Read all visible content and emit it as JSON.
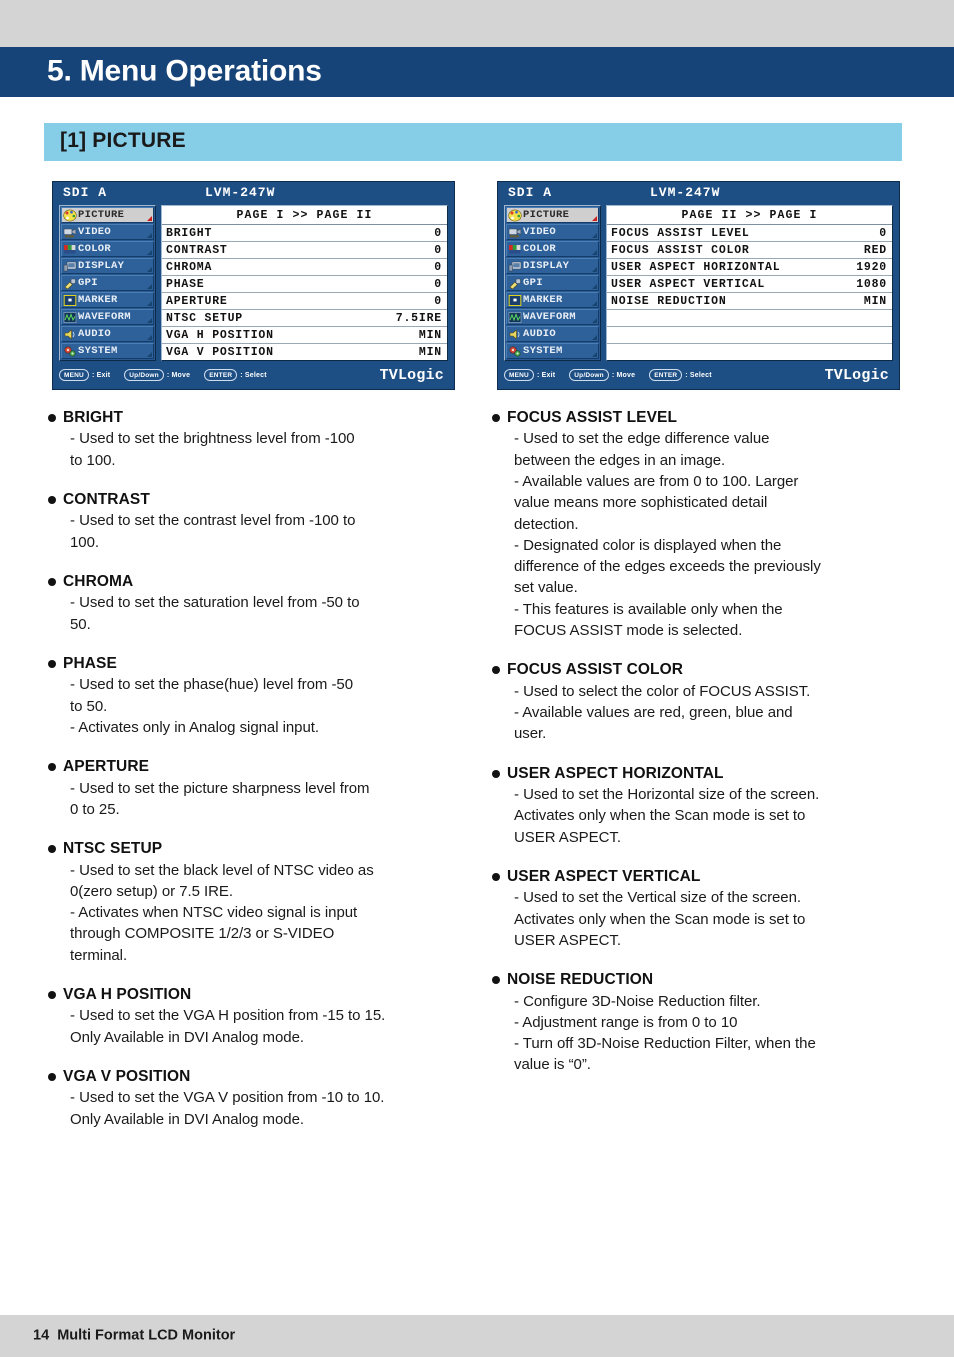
{
  "chapter": {
    "title": "5. Menu Operations"
  },
  "section": {
    "title": "[1] PICTURE"
  },
  "osd_panels": [
    {
      "source": "SDI A",
      "model": "LVM-247W",
      "page_label": "PAGE I >> PAGE II",
      "menu_items": [
        {
          "label": "PICTURE",
          "icon": "palette-icon",
          "active": true
        },
        {
          "label": "VIDEO",
          "icon": "camcorder-icon",
          "active": false
        },
        {
          "label": "COLOR",
          "icon": "color-bars-icon",
          "active": false
        },
        {
          "label": "DISPLAY",
          "icon": "monitor-icon",
          "active": false
        },
        {
          "label": "GPI",
          "icon": "plug-icon",
          "active": false
        },
        {
          "label": "MARKER",
          "icon": "frame-icon",
          "active": false
        },
        {
          "label": "WAVEFORM",
          "icon": "waveform-icon",
          "active": false
        },
        {
          "label": "AUDIO",
          "icon": "speaker-icon",
          "active": false
        },
        {
          "label": "SYSTEM",
          "icon": "gears-icon",
          "active": false
        }
      ],
      "rows": [
        {
          "label": "BRIGHT",
          "value": "0"
        },
        {
          "label": "CONTRAST",
          "value": "0"
        },
        {
          "label": "CHROMA",
          "value": "0"
        },
        {
          "label": "PHASE",
          "value": "0"
        },
        {
          "label": "APERTURE",
          "value": "0"
        },
        {
          "label": "NTSC SETUP",
          "value": "7.5IRE"
        },
        {
          "label": "VGA H POSITION",
          "value": "MIN"
        },
        {
          "label": "VGA V POSITION",
          "value": "MIN"
        }
      ],
      "footer": {
        "keys": [
          {
            "cap": "MENU",
            "text": ": Exit"
          },
          {
            "cap": "Up/Down",
            "text": ": Move"
          },
          {
            "cap": "ENTER",
            "text": ": Select"
          }
        ],
        "brand": "TVLogic"
      }
    },
    {
      "source": "SDI A",
      "model": "LVM-247W",
      "page_label": "PAGE II >> PAGE I",
      "menu_items": [
        {
          "label": "PICTURE",
          "icon": "palette-icon",
          "active": true
        },
        {
          "label": "VIDEO",
          "icon": "camcorder-icon",
          "active": false
        },
        {
          "label": "COLOR",
          "icon": "color-bars-icon",
          "active": false
        },
        {
          "label": "DISPLAY",
          "icon": "monitor-icon",
          "active": false
        },
        {
          "label": "GPI",
          "icon": "plug-icon",
          "active": false
        },
        {
          "label": "MARKER",
          "icon": "frame-icon",
          "active": false
        },
        {
          "label": "WAVEFORM",
          "icon": "waveform-icon",
          "active": false
        },
        {
          "label": "AUDIO",
          "icon": "speaker-icon",
          "active": false
        },
        {
          "label": "SYSTEM",
          "icon": "gears-icon",
          "active": false
        }
      ],
      "rows": [
        {
          "label": "FOCUS ASSIST LEVEL",
          "value": "0"
        },
        {
          "label": "FOCUS ASSIST COLOR",
          "value": "RED"
        },
        {
          "label": "USER ASPECT HORIZONTAL",
          "value": "1920"
        },
        {
          "label": "USER ASPECT VERTICAL",
          "value": "1080"
        },
        {
          "label": "NOISE REDUCTION",
          "value": "MIN"
        },
        {
          "label": "",
          "value": ""
        },
        {
          "label": "",
          "value": ""
        },
        {
          "label": "",
          "value": ""
        }
      ],
      "footer": {
        "keys": [
          {
            "cap": "MENU",
            "text": ": Exit"
          },
          {
            "cap": "Up/Down",
            "text": ": Move"
          },
          {
            "cap": "ENTER",
            "text": ": Select"
          }
        ],
        "brand": "TVLogic"
      }
    }
  ],
  "left_column": [
    {
      "title": "BRIGHT",
      "lines": [
        "- Used to set the brightness level from -100",
        "to 100."
      ]
    },
    {
      "title": "CONTRAST",
      "lines": [
        "- Used to set the contrast level from -100 to",
        "100."
      ]
    },
    {
      "title": "CHROMA",
      "lines": [
        "- Used to set the saturation level from -50 to",
        "50."
      ]
    },
    {
      "title": "PHASE",
      "lines": [
        "- Used to set the phase(hue) level from -50",
        "to 50.",
        "- Activates only in Analog signal input."
      ]
    },
    {
      "title": "APERTURE",
      "lines": [
        "- Used to set the picture sharpness level from",
        "0 to 25."
      ]
    },
    {
      "title": "NTSC SETUP",
      "lines": [
        "- Used to set the black level of NTSC video as",
        "0(zero setup) or 7.5 IRE.",
        "- Activates when NTSC video signal is input",
        "through COMPOSITE 1/2/3 or S-VIDEO",
        "terminal."
      ]
    },
    {
      "title": "VGA H POSITION",
      "lines": [
        "- Used to set the VGA H position from -15 to 15.",
        "Only Available in DVI Analog mode."
      ]
    },
    {
      "title": "VGA V POSITION",
      "lines": [
        "- Used to set the VGA V position from -10 to 10.",
        "Only Available in DVI Analog mode."
      ]
    }
  ],
  "right_column": [
    {
      "title": "FOCUS ASSIST LEVEL",
      "lines": [
        "- Used to set the edge difference value",
        "between the edges in an image.",
        "- Available values are from 0 to 100. Larger",
        "value means more sophisticated detail",
        "detection.",
        "- Designated color is displayed when the",
        "difference of the edges exceeds the previously",
        "set value.",
        "- This features is available only when the",
        "FOCUS ASSIST mode is selected."
      ]
    },
    {
      "title": "FOCUS ASSIST COLOR",
      "lines": [
        "- Used to select the color of FOCUS ASSIST.",
        "- Available values are red, green, blue and",
        "user."
      ]
    },
    {
      "title": "USER ASPECT HORIZONTAL",
      "lines": [
        "- Used to set the Horizontal size of the screen.",
        "Activates only when the Scan mode is set to",
        "USER ASPECT."
      ]
    },
    {
      "title": "USER ASPECT VERTICAL",
      "lines": [
        "- Used to set the Vertical size of the screen.",
        "Activates only when the Scan mode is set to",
        "USER ASPECT."
      ]
    },
    {
      "title": "NOISE REDUCTION",
      "lines": [
        "- Configure 3D-Noise Reduction filter.",
        "- Adjustment range is from 0 to 10",
        "- Turn off 3D-Noise Reduction Filter, when the",
        "value is “0”."
      ]
    }
  ],
  "page_footer": {
    "page_number": "14",
    "product": "Multi Format LCD Monitor"
  },
  "colors": {
    "header_navy": "#174478",
    "section_blue": "#86cde8",
    "gray_band": "#d4d4d4",
    "osd_blue": "#1d4e84",
    "osd_item_blue": "#2e6099",
    "active_item": "#cfcfcf"
  }
}
